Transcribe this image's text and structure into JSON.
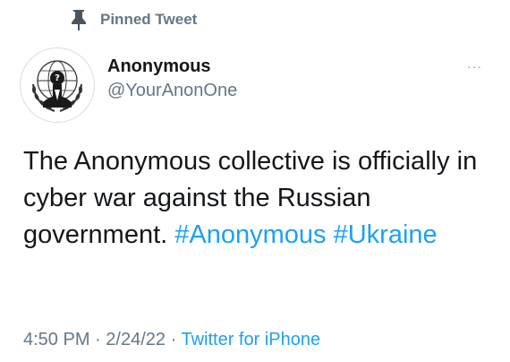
{
  "pinned": {
    "label": "Pinned Tweet",
    "icon": "pin-icon"
  },
  "author": {
    "display_name": "Anonymous",
    "handle": "@YourAnonOne",
    "avatar_icon": "anonymous-logo"
  },
  "tweet": {
    "text": "The Anonymous collective is officially in cyber war against the Russian government.",
    "hashtags": [
      "#Anonymous",
      "#Ukraine"
    ],
    "more_label": "···"
  },
  "meta": {
    "time": "4:50 PM",
    "date": "2/24/22",
    "separator": "·",
    "source": "Twitter for iPhone"
  },
  "colors": {
    "link": "#1da1f2",
    "muted": "#657786",
    "text": "#14171a"
  }
}
